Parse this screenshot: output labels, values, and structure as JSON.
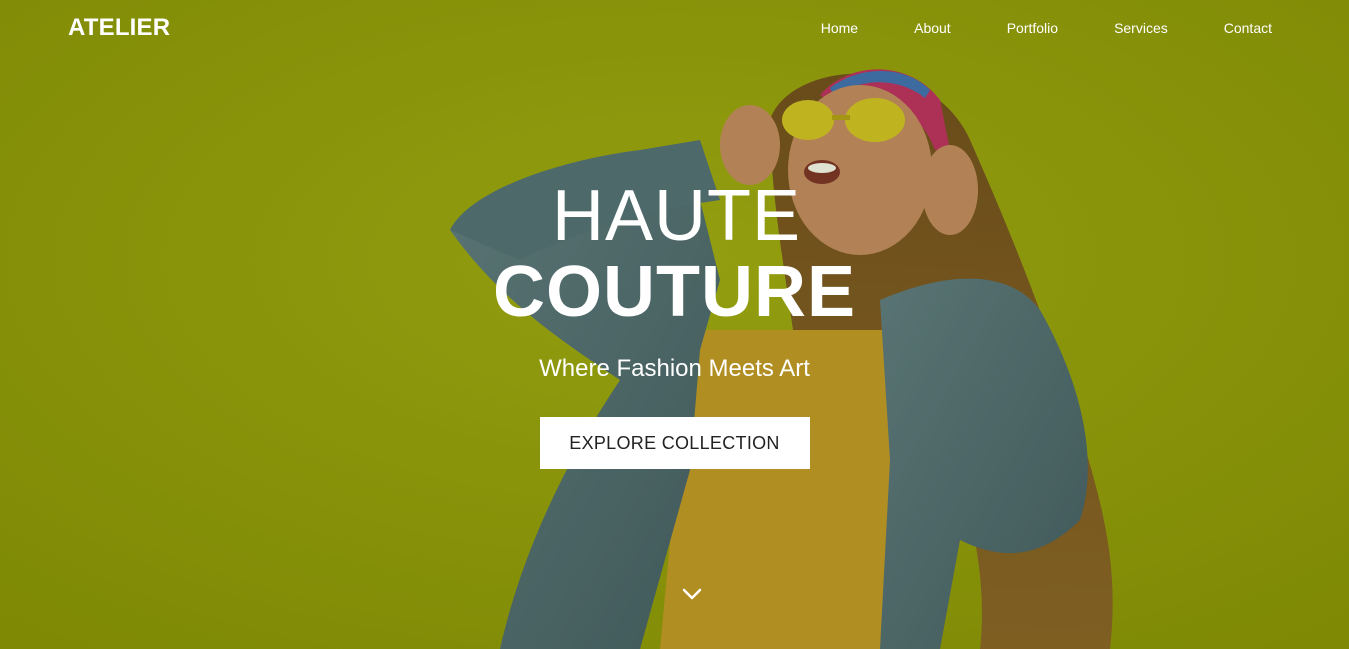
{
  "brand": {
    "name": "ATELIER"
  },
  "nav": {
    "items": [
      {
        "label": "Home"
      },
      {
        "label": "About"
      },
      {
        "label": "Portfolio"
      },
      {
        "label": "Services"
      },
      {
        "label": "Contact"
      }
    ]
  },
  "hero": {
    "title_line1": "HAUTE",
    "title_line2": "COUTURE",
    "subtitle": "Where Fashion Meets Art",
    "cta_label": "EXPLORE COLLECTION",
    "scroll_icon": "chevron-down-icon",
    "background_color": "#8f9a08"
  }
}
